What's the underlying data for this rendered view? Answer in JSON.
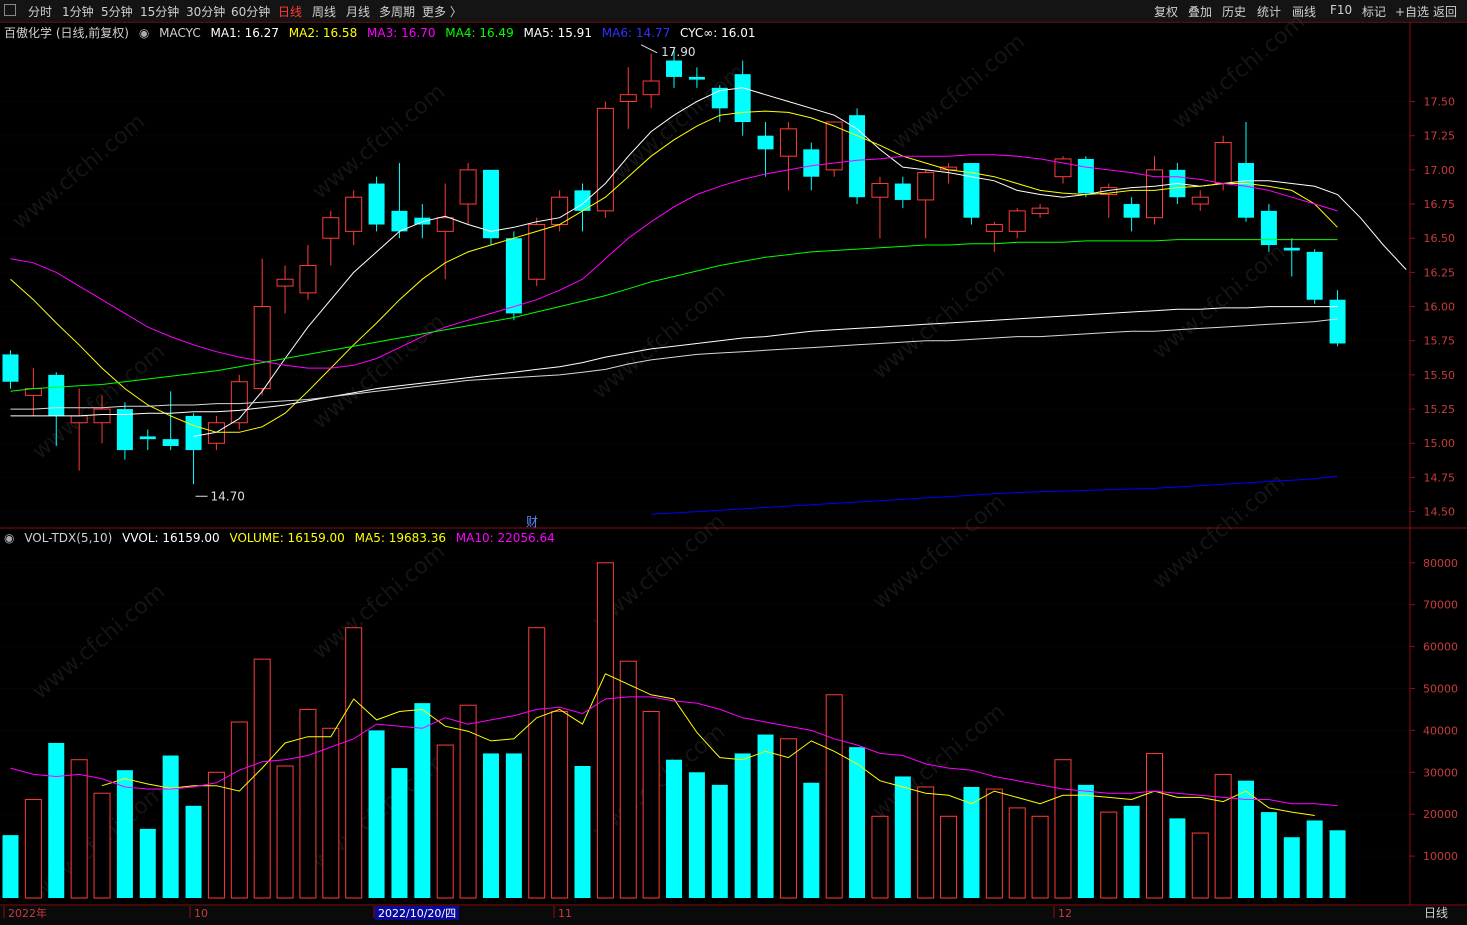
{
  "toolbar": {
    "periods": [
      "分时",
      "1分钟",
      "5分钟",
      "15分钟",
      "30分钟",
      "60分钟",
      "日线",
      "周线",
      "月线",
      "多周期",
      "更多 〉"
    ],
    "active_period": "日线",
    "right_tools": [
      "复权",
      "叠加",
      "历史",
      "统计",
      "画线",
      "F10",
      "标记",
      "+自选",
      "返回"
    ]
  },
  "indicator": {
    "stock": "百傲化学 (日线,前复权)",
    "name": "MACYC",
    "ma1": "MA1: 16.27",
    "ma2": "MA2: 16.58",
    "ma3": "MA3: 16.70",
    "ma4": "MA4: 16.49",
    "ma5": "MA5: 15.91",
    "ma6": "MA6: 14.77",
    "cyc": "CYC∞: 16.01"
  },
  "volume_indicator": {
    "name": "VOL-TDX(5,10)",
    "vvol": "VVOL: 16159.00",
    "volume": "VOLUME: 16159.00",
    "ma5": "MA5: 19683.36",
    "ma10": "MA10: 22056.64"
  },
  "annotations": {
    "high": "17.90",
    "low": "14.70",
    "fin_marker": "财"
  },
  "date_axis": {
    "labels": [
      "2022年",
      "10",
      "2022/10/20/四",
      "11",
      "12"
    ]
  },
  "period_footer": "日线",
  "colors": {
    "up": "#ff3b3b",
    "down": "#00ffff",
    "ma1": "#ffffff",
    "ma2": "#ffff00",
    "ma3": "#ff00ff",
    "ma4": "#00ff00",
    "ma5": "#ffffff",
    "ma6": "#0000ff",
    "bg": "#000000",
    "grid": "#5a0000"
  },
  "chart_data": {
    "type": "candlestick",
    "price_axis": {
      "ticks": [
        "17.50",
        "17.25",
        "17.00",
        "16.75",
        "16.50",
        "16.25",
        "16.00",
        "15.75",
        "15.50",
        "15.25",
        "15.00",
        "14.75",
        "14.50"
      ],
      "ylim": [
        14.38,
        17.95
      ]
    },
    "volume_axis": {
      "ticks": [
        "80000",
        "70000",
        "60000",
        "50000",
        "40000",
        "30000",
        "20000",
        "10000"
      ],
      "ylim": [
        0,
        84000
      ]
    },
    "candles": [
      {
        "o": 15.65,
        "h": 15.68,
        "c": 15.45,
        "l": 15.4,
        "v": 15000
      },
      {
        "o": 15.35,
        "h": 15.55,
        "c": 15.4,
        "l": 15.2,
        "v": 23500
      },
      {
        "o": 15.5,
        "h": 15.52,
        "c": 15.2,
        "l": 14.98,
        "v": 37000
      },
      {
        "o": 15.15,
        "h": 15.4,
        "c": 15.2,
        "l": 14.8,
        "v": 33000
      },
      {
        "o": 15.15,
        "h": 15.35,
        "c": 15.25,
        "l": 15.0,
        "v": 25000
      },
      {
        "o": 15.25,
        "h": 15.3,
        "c": 14.95,
        "l": 14.88,
        "v": 30500
      },
      {
        "o": 15.05,
        "h": 15.1,
        "c": 15.03,
        "l": 14.95,
        "v": 16500
      },
      {
        "o": 15.03,
        "h": 15.38,
        "c": 14.98,
        "l": 14.95,
        "v": 34000
      },
      {
        "o": 15.2,
        "h": 15.22,
        "c": 14.95,
        "l": 14.7,
        "v": 22000
      },
      {
        "o": 15.0,
        "h": 15.2,
        "c": 15.15,
        "l": 14.95,
        "v": 30000
      },
      {
        "o": 15.15,
        "h": 15.5,
        "c": 15.45,
        "l": 15.1,
        "v": 42000
      },
      {
        "o": 15.4,
        "h": 16.35,
        "c": 16.0,
        "l": 15.35,
        "v": 57000
      },
      {
        "o": 16.15,
        "h": 16.3,
        "c": 16.2,
        "l": 15.95,
        "v": 31500
      },
      {
        "o": 16.1,
        "h": 16.45,
        "c": 16.3,
        "l": 16.05,
        "v": 45000
      },
      {
        "o": 16.5,
        "h": 16.7,
        "c": 16.65,
        "l": 16.3,
        "v": 40500
      },
      {
        "o": 16.55,
        "h": 16.85,
        "c": 16.8,
        "l": 16.45,
        "v": 64500
      },
      {
        "o": 16.9,
        "h": 16.95,
        "c": 16.6,
        "l": 16.55,
        "v": 40000
      },
      {
        "o": 16.7,
        "h": 17.05,
        "c": 16.55,
        "l": 16.5,
        "v": 31000
      },
      {
        "o": 16.65,
        "h": 16.75,
        "c": 16.6,
        "l": 16.5,
        "v": 46500
      },
      {
        "o": 16.55,
        "h": 16.9,
        "c": 16.65,
        "l": 16.2,
        "v": 36500
      },
      {
        "o": 16.75,
        "h": 17.05,
        "c": 17.0,
        "l": 16.6,
        "v": 46000
      },
      {
        "o": 17.0,
        "h": 17.0,
        "c": 16.5,
        "l": 16.45,
        "v": 34500
      },
      {
        "o": 16.5,
        "h": 16.55,
        "c": 15.95,
        "l": 15.9,
        "v": 34500
      },
      {
        "o": 16.2,
        "h": 16.65,
        "c": 16.6,
        "l": 16.15,
        "v": 64500
      },
      {
        "o": 16.6,
        "h": 16.85,
        "c": 16.8,
        "l": 16.55,
        "v": 44500
      },
      {
        "o": 16.85,
        "h": 16.9,
        "c": 16.7,
        "l": 16.55,
        "v": 31500
      },
      {
        "o": 16.7,
        "h": 17.5,
        "c": 17.45,
        "l": 16.65,
        "v": 80000
      },
      {
        "o": 17.5,
        "h": 17.75,
        "c": 17.55,
        "l": 17.3,
        "v": 56500
      },
      {
        "o": 17.55,
        "h": 17.85,
        "c": 17.65,
        "l": 17.45,
        "v": 44500
      },
      {
        "o": 17.8,
        "h": 17.9,
        "c": 17.68,
        "l": 17.6,
        "v": 33000
      },
      {
        "o": 17.68,
        "h": 17.75,
        "c": 17.66,
        "l": 17.6,
        "v": 30000
      },
      {
        "o": 17.6,
        "h": 17.62,
        "c": 17.45,
        "l": 17.35,
        "v": 27000
      },
      {
        "o": 17.7,
        "h": 17.8,
        "c": 17.35,
        "l": 17.25,
        "v": 34500
      },
      {
        "o": 17.25,
        "h": 17.35,
        "c": 17.15,
        "l": 16.95,
        "v": 39000
      },
      {
        "o": 17.1,
        "h": 17.35,
        "c": 17.3,
        "l": 16.85,
        "v": 38000
      },
      {
        "o": 17.15,
        "h": 17.2,
        "c": 16.95,
        "l": 16.85,
        "v": 27500
      },
      {
        "o": 17.0,
        "h": 17.35,
        "c": 17.35,
        "l": 16.95,
        "v": 48500
      },
      {
        "o": 17.4,
        "h": 17.45,
        "c": 16.8,
        "l": 16.75,
        "v": 36000
      },
      {
        "o": 16.8,
        "h": 16.95,
        "c": 16.9,
        "l": 16.5,
        "v": 19500
      },
      {
        "o": 16.9,
        "h": 16.95,
        "c": 16.78,
        "l": 16.72,
        "v": 29000
      },
      {
        "o": 16.78,
        "h": 17.0,
        "c": 16.98,
        "l": 16.5,
        "v": 26500
      },
      {
        "o": 17.0,
        "h": 17.05,
        "c": 17.02,
        "l": 16.9,
        "v": 19500
      },
      {
        "o": 17.05,
        "h": 17.05,
        "c": 16.65,
        "l": 16.6,
        "v": 26500
      },
      {
        "o": 16.55,
        "h": 16.62,
        "c": 16.6,
        "l": 16.4,
        "v": 26000
      },
      {
        "o": 16.55,
        "h": 16.72,
        "c": 16.7,
        "l": 16.5,
        "v": 21500
      },
      {
        "o": 16.68,
        "h": 16.75,
        "c": 16.72,
        "l": 16.65,
        "v": 19500
      },
      {
        "o": 16.95,
        "h": 17.1,
        "c": 17.08,
        "l": 16.9,
        "v": 33000
      },
      {
        "o": 17.08,
        "h": 17.1,
        "c": 16.83,
        "l": 16.8,
        "v": 27000
      },
      {
        "o": 16.82,
        "h": 16.9,
        "c": 16.87,
        "l": 16.65,
        "v": 20500
      },
      {
        "o": 16.75,
        "h": 16.8,
        "c": 16.65,
        "l": 16.55,
        "v": 22000
      },
      {
        "o": 16.65,
        "h": 17.1,
        "c": 17.0,
        "l": 16.6,
        "v": 34500
      },
      {
        "o": 17.0,
        "h": 17.05,
        "c": 16.8,
        "l": 16.75,
        "v": 19000
      },
      {
        "o": 16.75,
        "h": 16.85,
        "c": 16.8,
        "l": 16.7,
        "v": 15500
      },
      {
        "o": 16.9,
        "h": 17.25,
        "c": 17.2,
        "l": 16.85,
        "v": 29500
      },
      {
        "o": 17.05,
        "h": 17.35,
        "c": 16.65,
        "l": 16.62,
        "v": 28000
      },
      {
        "o": 16.7,
        "h": 16.75,
        "c": 16.45,
        "l": 16.4,
        "v": 20500
      },
      {
        "o": 16.43,
        "h": 16.5,
        "c": 16.41,
        "l": 16.22,
        "v": 14500
      },
      {
        "o": 16.4,
        "h": 16.42,
        "c": 16.05,
        "l": 16.02,
        "v": 18500
      },
      {
        "o": 16.05,
        "h": 16.12,
        "c": 15.73,
        "l": 15.71,
        "v": 16159
      }
    ],
    "ma_lines": [
      {
        "name": "MA1",
        "color": "#ffffff",
        "start": 8,
        "values": [
          15.05,
          15.08,
          15.18,
          15.38,
          15.62,
          15.85,
          16.05,
          16.25,
          16.4,
          16.55,
          16.62,
          16.66,
          16.6,
          16.55,
          16.58,
          16.62,
          16.65,
          16.75,
          16.9,
          17.1,
          17.28,
          17.4,
          17.5,
          17.58,
          17.6,
          17.55,
          17.5,
          17.45,
          17.4,
          17.3,
          17.15,
          17.02,
          17.0,
          16.98,
          16.95,
          16.92,
          16.85,
          16.82,
          16.8,
          16.82,
          16.85,
          16.87,
          16.88,
          16.9,
          16.88,
          16.9,
          16.92,
          16.92,
          16.9,
          16.88,
          16.82,
          16.65,
          16.45,
          16.27
        ]
      },
      {
        "name": "MA2",
        "color": "#ffff00",
        "start": 0,
        "values": [
          16.2,
          16.05,
          15.88,
          15.72,
          15.55,
          15.4,
          15.28,
          15.2,
          15.13,
          15.08,
          15.08,
          15.12,
          15.22,
          15.38,
          15.55,
          15.72,
          15.88,
          16.05,
          16.2,
          16.32,
          16.4,
          16.45,
          16.5,
          16.55,
          16.6,
          16.7,
          16.8,
          16.95,
          17.1,
          17.22,
          17.32,
          17.4,
          17.42,
          17.43,
          17.42,
          17.38,
          17.32,
          17.25,
          17.18,
          17.1,
          17.05,
          17.0,
          16.98,
          16.95,
          16.9,
          16.85,
          16.83,
          16.82,
          16.83,
          16.85,
          16.85,
          16.87,
          16.88,
          16.9,
          16.9,
          16.88,
          16.85,
          16.75,
          16.58
        ]
      },
      {
        "name": "MA3",
        "color": "#ff00ff",
        "start": 0,
        "values": [
          16.35,
          16.32,
          16.25,
          16.15,
          16.05,
          15.95,
          15.85,
          15.78,
          15.72,
          15.67,
          15.63,
          15.6,
          15.57,
          15.55,
          15.55,
          15.57,
          15.62,
          15.7,
          15.78,
          15.85,
          15.9,
          15.95,
          16.0,
          16.05,
          16.12,
          16.2,
          16.35,
          16.5,
          16.62,
          16.73,
          16.82,
          16.88,
          16.93,
          16.97,
          17.0,
          17.03,
          17.05,
          17.07,
          17.08,
          17.1,
          17.1,
          17.1,
          17.11,
          17.11,
          17.1,
          17.08,
          17.05,
          17.02,
          17.0,
          16.98,
          16.95,
          16.95,
          16.93,
          16.9,
          16.88,
          16.85,
          16.8,
          16.75,
          16.7
        ]
      },
      {
        "name": "MA4",
        "color": "#00ff00",
        "start": 0,
        "values": [
          15.38,
          15.4,
          15.41,
          15.42,
          15.43,
          15.45,
          15.47,
          15.49,
          15.51,
          15.53,
          15.56,
          15.59,
          15.62,
          15.65,
          15.68,
          15.71,
          15.74,
          15.77,
          15.8,
          15.83,
          15.86,
          15.89,
          15.92,
          15.96,
          16.0,
          16.04,
          16.08,
          16.13,
          16.18,
          16.22,
          16.26,
          16.3,
          16.33,
          16.36,
          16.38,
          16.4,
          16.41,
          16.42,
          16.43,
          16.44,
          16.45,
          16.45,
          16.46,
          16.46,
          16.47,
          16.47,
          16.47,
          16.48,
          16.48,
          16.48,
          16.48,
          16.49,
          16.49,
          16.49,
          16.49,
          16.49,
          16.49,
          16.49,
          16.49
        ]
      },
      {
        "name": "MA5",
        "color": "#ffffff",
        "start": 0,
        "values": [
          15.2,
          15.2,
          15.2,
          15.2,
          15.21,
          15.21,
          15.22,
          15.22,
          15.23,
          15.23,
          15.24,
          15.26,
          15.28,
          15.31,
          15.34,
          15.37,
          15.4,
          15.42,
          15.44,
          15.46,
          15.48,
          15.5,
          15.52,
          15.54,
          15.56,
          15.59,
          15.63,
          15.66,
          15.69,
          15.71,
          15.73,
          15.75,
          15.77,
          15.78,
          15.8,
          15.82,
          15.83,
          15.84,
          15.85,
          15.86,
          15.87,
          15.88,
          15.89,
          15.9,
          15.91,
          15.92,
          15.93,
          15.94,
          15.95,
          15.96,
          15.97,
          15.98,
          15.98,
          15.99,
          15.99,
          16.0,
          16.0,
          16.0,
          16.0
        ]
      },
      {
        "name": "CYC",
        "color": "#d8d8d8",
        "start": 0,
        "values": [
          15.25,
          15.25,
          15.26,
          15.26,
          15.26,
          15.27,
          15.27,
          15.28,
          15.28,
          15.29,
          15.29,
          15.3,
          15.31,
          15.32,
          15.34,
          15.36,
          15.38,
          15.4,
          15.42,
          15.44,
          15.46,
          15.47,
          15.48,
          15.49,
          15.5,
          15.52,
          15.54,
          15.58,
          15.61,
          15.63,
          15.65,
          15.66,
          15.67,
          15.68,
          15.69,
          15.7,
          15.71,
          15.72,
          15.73,
          15.74,
          15.75,
          15.75,
          15.76,
          15.77,
          15.78,
          15.78,
          15.79,
          15.8,
          15.81,
          15.82,
          15.82,
          15.83,
          15.84,
          15.85,
          15.86,
          15.87,
          15.88,
          15.89,
          15.91
        ]
      },
      {
        "name": "MA6",
        "color": "#0000ff",
        "start": 28,
        "values": [
          14.48,
          14.49,
          14.5,
          14.51,
          14.52,
          14.53,
          14.54,
          14.55,
          14.56,
          14.57,
          14.58,
          14.59,
          14.6,
          14.61,
          14.62,
          14.63,
          14.64,
          14.645,
          14.65,
          14.655,
          14.66,
          14.665,
          14.67,
          14.68,
          14.69,
          14.7,
          14.71,
          14.72,
          14.73,
          14.74,
          14.76
        ]
      }
    ],
    "volume_ma_lines": [
      {
        "name": "MA5",
        "color": "#ffff00",
        "start": 4,
        "values": [
          26800,
          28500,
          27200,
          26200,
          26800,
          26800,
          25500,
          31000,
          37000,
          38500,
          38500,
          47500,
          42500,
          44500,
          45000,
          41000,
          39800,
          37500,
          38000,
          43000,
          45000,
          41500,
          53500,
          51000,
          48500,
          47500,
          39500,
          33500,
          33000,
          35000,
          33500,
          37500,
          35000,
          32000,
          28000,
          26500,
          25000,
          24500,
          22500,
          25500,
          24000,
          22500,
          24500,
          24500,
          24000,
          23500,
          25500,
          24000,
          24000,
          23000,
          25500,
          21500,
          20500,
          19683
        ]
      },
      {
        "name": "MA10",
        "color": "#ff00ff",
        "start": 0,
        "values": [
          31000,
          29500,
          29000,
          29500,
          28500,
          26500,
          26000,
          26000,
          26500,
          27500,
          30500,
          32500,
          33000,
          34000,
          36000,
          38000,
          41500,
          41000,
          40500,
          43000,
          41500,
          42500,
          43500,
          45000,
          45500,
          44000,
          47500,
          48000,
          48000,
          47000,
          46500,
          45000,
          43000,
          42000,
          41000,
          40000,
          38000,
          36500,
          34500,
          34000,
          32000,
          31000,
          30500,
          29000,
          28000,
          27000,
          26000,
          25500,
          25000,
          25000,
          25500,
          25000,
          24500,
          24000,
          23500,
          23500,
          22500,
          22500,
          22057
        ]
      }
    ]
  }
}
